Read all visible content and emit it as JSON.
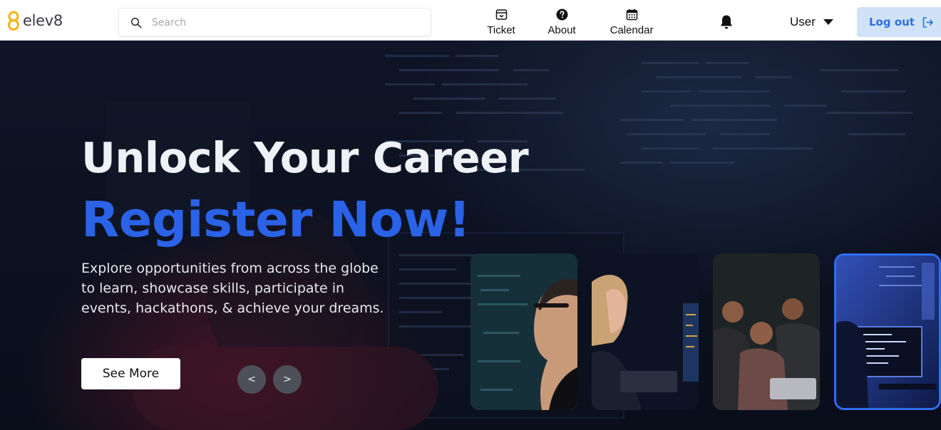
{
  "brand": {
    "name": "elev8",
    "logo_color": "#f5b21b"
  },
  "search": {
    "placeholder": "Search",
    "value": ""
  },
  "nav": {
    "items": [
      {
        "label": "Ticket",
        "icon": "ticket-icon"
      },
      {
        "label": "About",
        "icon": "question-circle-icon"
      },
      {
        "label": "Calendar",
        "icon": "calendar-icon"
      }
    ],
    "notifications_icon": "bell-icon",
    "user_label": "User",
    "logout_label": "Log out"
  },
  "hero": {
    "title_line1": "Unlock Your Career",
    "title_line2": "Register Now!",
    "description_lines": [
      "Explore opportunities from across the globe",
      "to learn, showcase skills, participate in",
      "events, hackathons, & achieve your dreams."
    ],
    "cta_label": "See More",
    "prev_label": "<",
    "next_label": ">",
    "accent_color": "#2a62e8",
    "slides": [
      {
        "subject": "man-with-glasses-photo"
      },
      {
        "subject": "woman-at-monitor-photo"
      },
      {
        "subject": "team-at-laptop-photo"
      },
      {
        "subject": "developer-at-screens-photo",
        "selected": true
      }
    ]
  },
  "colors": {
    "logout_bg": "#cfe2f8",
    "logout_text": "#2d6fdd",
    "selected_border": "#2f6df0"
  }
}
